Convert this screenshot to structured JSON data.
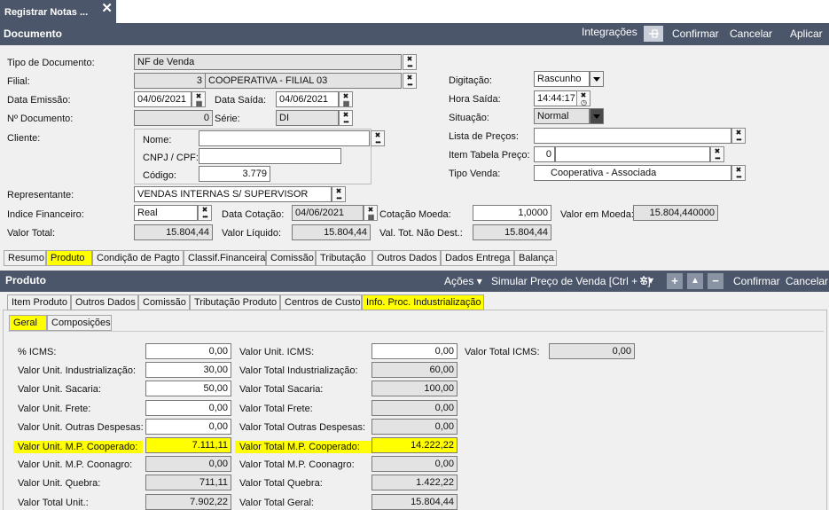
{
  "window_tab": {
    "title": "Registrar Notas ...",
    "close": "✕"
  },
  "doc_bar": {
    "title": "Documento",
    "integracoes": "Integrações",
    "confirmar": "Confirmar",
    "cancelar": "Cancelar",
    "aplicar": "Aplicar"
  },
  "doc": {
    "tipo_documento": {
      "label": "Tipo de Documento:",
      "value": "NF de Venda"
    },
    "filial": {
      "label": "Filial:",
      "code": "3",
      "name": "COOPERATIVA - FILIAL 03"
    },
    "data_emissao": {
      "label": "Data Emissão:",
      "value": "04/06/2021"
    },
    "data_saida": {
      "label": "Data Saída:",
      "value": "04/06/2021"
    },
    "n_documento": {
      "label": "Nº Documento:",
      "value": "0"
    },
    "serie": {
      "label": "Série:",
      "value": "DI"
    },
    "cliente": {
      "label": "Cliente:",
      "nome_label": "Nome:",
      "nome": "",
      "cnpj_label": "CNPJ / CPF:",
      "cnpj": "",
      "codigo_label": "Código:",
      "codigo": "3.779"
    },
    "digitacao": {
      "label": "Digitação:",
      "value": "Rascunho"
    },
    "hora_saida": {
      "label": "Hora Saída:",
      "value": "14:44:17"
    },
    "situacao": {
      "label": "Situação:",
      "value": "Normal"
    },
    "lista_precos": {
      "label": "Lista de Preços:",
      "value": ""
    },
    "item_tabela_preco": {
      "label": "Item Tabela Preço:",
      "value": "0"
    },
    "tipo_venda": {
      "label": "Tipo Venda:",
      "value": "Cooperativa - Associada"
    },
    "representante": {
      "label": "Representante:",
      "value": "VENDAS INTERNAS S/ SUPERVISOR"
    },
    "indice_financeiro": {
      "label": "Indice Financeiro:",
      "value": "Real"
    },
    "data_cotacao": {
      "label": "Data Cotação:",
      "value": "04/06/2021"
    },
    "cotacao_moeda": {
      "label": "Cotação Moeda:",
      "value": "1,0000"
    },
    "valor_em_moeda": {
      "label": "Valor em Moeda:",
      "value": "15.804,440000"
    },
    "valor_total": {
      "label": "Valor Total:",
      "value": "15.804,44"
    },
    "valor_liquido": {
      "label": "Valor Líquido:",
      "value": "15.804,44"
    },
    "val_tot_nao_dest": {
      "label": "Val. Tot. Não Dest.:",
      "value": "15.804,44"
    }
  },
  "main_tabs": [
    "Resumo",
    "Produto",
    "Condição de Pagto",
    "Classif.Financeira",
    "Comissão",
    "Tributação",
    "Outros Dados",
    "Dados Entrega",
    "Balança"
  ],
  "prod_bar": {
    "title": "Produto",
    "acoes": "Ações",
    "simular": "Simular Preço de Venda [Ctrl + S]",
    "confirmar": "Confirmar",
    "cancelar": "Cancelar"
  },
  "prod_tabs": [
    "Item Produto",
    "Outros Dados",
    "Comissão",
    "Tributação Produto",
    "Centros de Custo",
    "Info. Proc. Industrialização"
  ],
  "sub_tabs": [
    "Geral",
    "Composições"
  ],
  "left_rows": [
    {
      "label": "% ICMS:",
      "value": "0,00"
    },
    {
      "label": "Valor Unit. Industrialização:",
      "value": "30,00"
    },
    {
      "label": "Valor Unit. Sacaria:",
      "value": "50,00"
    },
    {
      "label": "Valor Unit. Frete:",
      "value": "0,00"
    },
    {
      "label": "Valor Unit. Outras Despesas:",
      "value": "0,00"
    },
    {
      "label": "Valor Unit. M.P. Cooperado:",
      "value": "7.111,11"
    },
    {
      "label": "Valor Unit. M.P. Coonagro:",
      "value": "0,00"
    },
    {
      "label": "Valor Unit. Quebra:",
      "value": "711,11"
    },
    {
      "label": "Valor Total Unit.:",
      "value": "7.902,22"
    }
  ],
  "right_rows": [
    {
      "label": "Valor Unit. ICMS:",
      "value": "0,00"
    },
    {
      "label": "Valor Total Industrialização:",
      "value": "60,00"
    },
    {
      "label": "Valor Total Sacaria:",
      "value": "100,00"
    },
    {
      "label": "Valor Total Frete:",
      "value": "0,00"
    },
    {
      "label": "Valor Total Outras Despesas:",
      "value": "0,00"
    },
    {
      "label": "Valor Total M.P. Cooperado:",
      "value": "14.222,22"
    },
    {
      "label": "Valor Total M.P. Coonagro:",
      "value": "0,00"
    },
    {
      "label": "Valor Total Quebra:",
      "value": "1.422,22"
    },
    {
      "label": "Valor Total Geral:",
      "value": "15.804,44"
    }
  ],
  "total_icms": {
    "label": "Valor Total ICMS:",
    "value": "0,00"
  }
}
